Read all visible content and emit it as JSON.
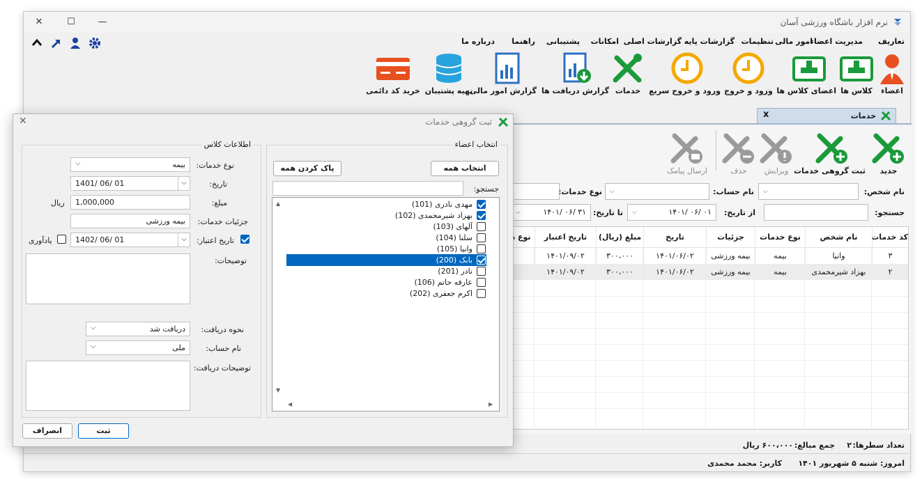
{
  "app": {
    "title": "نرم افزار باشگاه ورزشی آسان"
  },
  "window_controls": {
    "minimize": "—",
    "maximize": "☐",
    "close": "✕"
  },
  "menu": [
    "تعاریف",
    "مدیریت اعضاء",
    "امور مالی",
    "تنظیمات",
    "گزارشات پایه",
    "گزارشات اصلی",
    "امکانات",
    "پشتیبانی",
    "راهنما",
    "درباره ما"
  ],
  "toolbar": [
    {
      "label": "اعضاء",
      "icon": "member-icon"
    },
    {
      "label": "کلاس ها",
      "icon": "class-icon"
    },
    {
      "label": "اعضای کلاس ها",
      "icon": "class-members-icon"
    },
    {
      "label": "ورود و خروج",
      "icon": "clock-icon"
    },
    {
      "label": "ورود و خروج سریع",
      "icon": "fast-clock-icon"
    },
    {
      "label": "خدمات",
      "icon": "services-icon"
    },
    {
      "label": "گزارش دریافت ها",
      "icon": "receipts-report-icon"
    },
    {
      "label": "گزارش امور مالی",
      "icon": "finance-report-icon"
    },
    {
      "label": "تهیه پشتیبان",
      "icon": "backup-database-icon"
    },
    {
      "label": "خرید کد دائمی",
      "icon": "credit-card-icon"
    }
  ],
  "doc_tab": {
    "label": "خدمات",
    "close": "x"
  },
  "services": {
    "actions": [
      {
        "label": "جدید",
        "enabled": true
      },
      {
        "label": "ثبت گروهی خدمات",
        "enabled": true
      },
      {
        "label": "ویرایش",
        "enabled": false
      },
      {
        "label": "حذف",
        "enabled": false
      },
      {
        "label": "ارسال پیامک",
        "enabled": false
      }
    ],
    "filters": {
      "person_label": "نام شخص:",
      "account_label": "نام حساب:",
      "service_type_label": "نوع خدمات:",
      "search_label": "جستجو:",
      "from_date_label": "از تاریخ:",
      "from_date": "۱۴۰۱/ ۰۶/ ۰۱",
      "to_date_label": "تا تاریخ:",
      "to_date": "۱۴۰۱/ ۰۶/ ۳۱"
    },
    "grid": {
      "headers": [
        "کد خدمات",
        "نام شخص",
        "نوع خدمات",
        "جزئیات",
        "تاریخ",
        "مبلغ (ریال)",
        "تاریخ اعتبار",
        "نوع د"
      ],
      "rows": [
        [
          "۳",
          "وانیا",
          "بیمه",
          "بیمه ورزشی",
          "۱۴۰۱/۰۶/۰۲",
          "۳۰۰،۰۰۰",
          "۱۴۰۱/۰۹/۰۲",
          ""
        ],
        [
          "۲",
          "بهزاد شیرمحمدی",
          "بیمه",
          "بیمه ورزشی",
          "۱۴۰۱/۰۶/۰۲",
          "۳۰۰،۰۰۰",
          "۱۴۰۱/۰۹/۰۲",
          ""
        ]
      ]
    },
    "summary": {
      "rows_label": "تعداد سطرها:",
      "rows_count": "۲",
      "sum_label": "جمع مبالغ:",
      "sum_value": "۶۰۰،۰۰۰ ریال"
    }
  },
  "status": {
    "today": "امروز: شنبه ۵ شهریور ۱۴۰۱",
    "user": "کاربر: محمد محمدی"
  },
  "dialog": {
    "title": "ثبت گروهی خدمات",
    "members_group": {
      "title": "انتخاب اعضاء",
      "select_all": "انتخاب همه",
      "clear_all": "پاک کردن همه",
      "search_label": "جستجو:",
      "search_value": "",
      "members": [
        {
          "name": "مهدی نادری (101)",
          "checked": true,
          "selected": false
        },
        {
          "name": "بهزاد شیرمحمدی (102)",
          "checked": true,
          "selected": false
        },
        {
          "name": "آلهای (103)",
          "checked": false,
          "selected": false
        },
        {
          "name": "سلنا (104)",
          "checked": false,
          "selected": false
        },
        {
          "name": "وانیا (105)",
          "checked": false,
          "selected": false
        },
        {
          "name": "بابک (200)",
          "checked": true,
          "selected": true
        },
        {
          "name": "نادر (201)",
          "checked": false,
          "selected": false
        },
        {
          "name": "عارفه حاتم (106)",
          "checked": false,
          "selected": false
        },
        {
          "name": "اکرم جعفری (202)",
          "checked": false,
          "selected": false
        }
      ]
    },
    "class_group": {
      "title": "اطلاعات کلاس",
      "service_type_label": "نوع خدمات:",
      "service_type": "بیمه",
      "date_label": "تاریخ:",
      "date": "1401/ 06/ 01",
      "amount_label": "مبلغ:",
      "amount": "1,000,000",
      "currency": "ریال",
      "details_label": "جزئیات خدمات:",
      "details": "بیمه ورزشی",
      "validity_label": "تاریخ اعتبار:",
      "validity_date": "1402/ 06/ 01",
      "reminder_label": "یادآوری",
      "notes_label": "توضیحات:",
      "receive_method_label": "نحوه دریافت:",
      "receive_method": "دریافت شد",
      "account_label": "نام حساب:",
      "account": "ملی",
      "receive_notes_label": "توضیحات دریافت:"
    },
    "buttons": {
      "submit": "ثبت",
      "cancel": "انصراف"
    }
  },
  "colors": {
    "accent": "#0067c0",
    "green": "#1a9a3a",
    "orange": "#f5a800",
    "red": "#e8501f",
    "blue": "#2d6fc4"
  }
}
